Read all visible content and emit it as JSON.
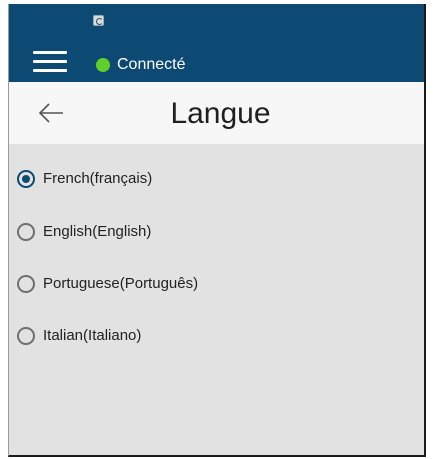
{
  "status_bar": {
    "notification_icon": "app-notification-icon"
  },
  "topbar": {
    "menu_icon": "hamburger-menu-icon",
    "status_text": "Connecté",
    "status_color": "#5fcf2b",
    "background_color": "#0c4a73"
  },
  "header": {
    "back_icon": "arrow-left-icon",
    "title": "Langue"
  },
  "languages": {
    "selected": "French(français)",
    "options": [
      {
        "label": "French(français)",
        "checked": true
      },
      {
        "label": "English(English)",
        "checked": false
      },
      {
        "label": "Portuguese(Português)",
        "checked": false
      },
      {
        "label": "Italian(Italiano)",
        "checked": false
      }
    ]
  }
}
